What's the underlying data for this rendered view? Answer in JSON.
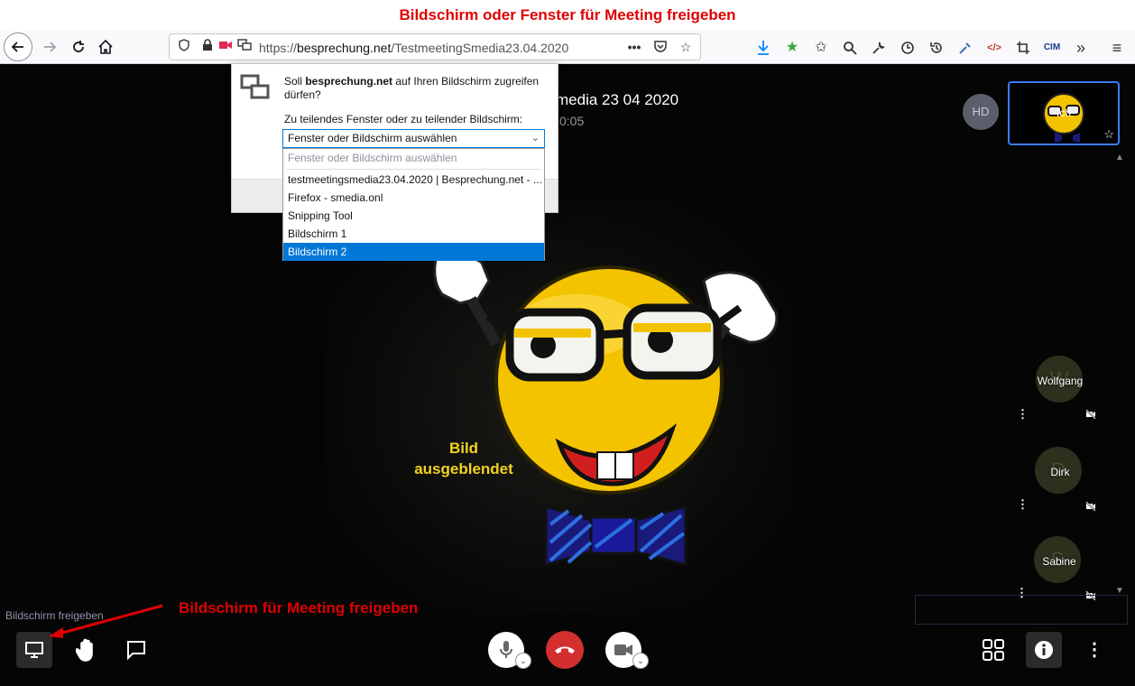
{
  "annotation_top": "Bildschirm oder Fenster für Meeting freigeben",
  "annotation_bottom": "Bildschirm für Meeting freigeben",
  "browser": {
    "url_scheme": "https://",
    "url_host": "besprechung.net",
    "url_path": "/TestmeetingSmedia23.04.2020"
  },
  "popup": {
    "question_prefix": "Soll ",
    "question_host": "besprechung.net",
    "question_suffix": " auf Ihren Bildschirm zugreifen dürfen?",
    "label": "Zu teilendes Fenster oder zu teilender Bildschirm:",
    "selected_value": "Fenster oder Bildschirm auswählen",
    "options": [
      "Fenster oder Bildschirm auswählen",
      "testmeetingsmedia23.04.2020 | Besprechung.net - ...",
      "Firefox -  smedia.onl",
      "Snipping Tool",
      "Bildschirm 1",
      "Bildschirm 2"
    ]
  },
  "meeting": {
    "title": "media 23 04 2020",
    "timer": "0:05",
    "image_hidden_line1": "Bild",
    "image_hidden_line2": "ausgeblendet",
    "self_initials": "HD",
    "self_label": "Ich",
    "participants": [
      {
        "name": "Wolfgang",
        "initial": "W"
      },
      {
        "name": "Dirk",
        "initial": "D"
      },
      {
        "name": "Sabine",
        "initial": "S"
      }
    ]
  },
  "bottom_bar": {
    "tooltip": "Bildschirm freigeben"
  },
  "colors": {
    "annotation_red": "#e00000",
    "hangup_red": "#d32f2f",
    "accent_blue": "#3b7cff",
    "select_blue": "#0078d7"
  }
}
